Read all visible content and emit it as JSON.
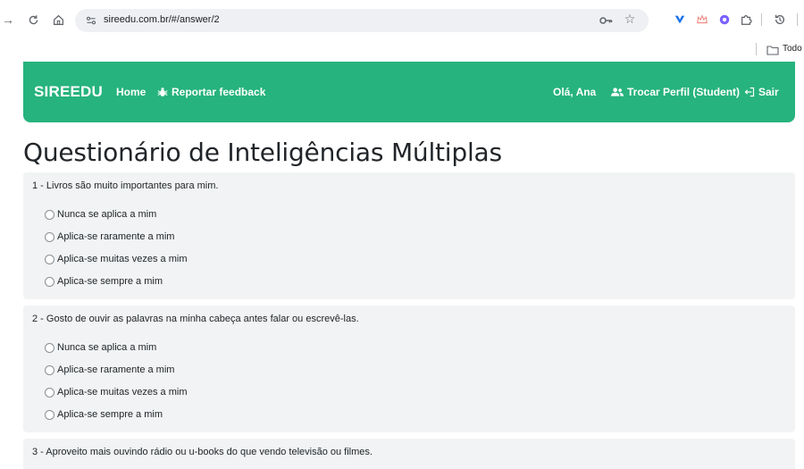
{
  "browser": {
    "url": "sireedu.com.br/#/answer/2",
    "bookmark_folder": "Todo"
  },
  "navbar": {
    "brand": "SIREEDU",
    "home": "Home",
    "feedback": "Reportar feedback",
    "greeting": "Olá, Ana",
    "switch_profile": "Trocar Perfil (Student)",
    "logout": "Sair"
  },
  "page": {
    "title": "Questionário de Inteligências Múltiplas"
  },
  "questions": [
    {
      "text": "1 - Livros são muito importantes para mim.",
      "options": [
        "Nunca se aplica a mim",
        "Aplica-se raramente a mim",
        "Aplica-se muitas vezes a mim",
        "Aplica-se sempre a mim"
      ]
    },
    {
      "text": "2 - Gosto de ouvir as palavras na minha cabeça antes falar ou escrevê-las.",
      "options": [
        "Nunca se aplica a mim",
        "Aplica-se raramente a mim",
        "Aplica-se muitas vezes a mim",
        "Aplica-se sempre a mim"
      ]
    },
    {
      "text": "3 - Aproveito mais ouvindo rádio ou u-books do que vendo televisão ou filmes."
    }
  ],
  "colors": {
    "navbar": "#26b37d",
    "card": "#f1f3f4"
  }
}
